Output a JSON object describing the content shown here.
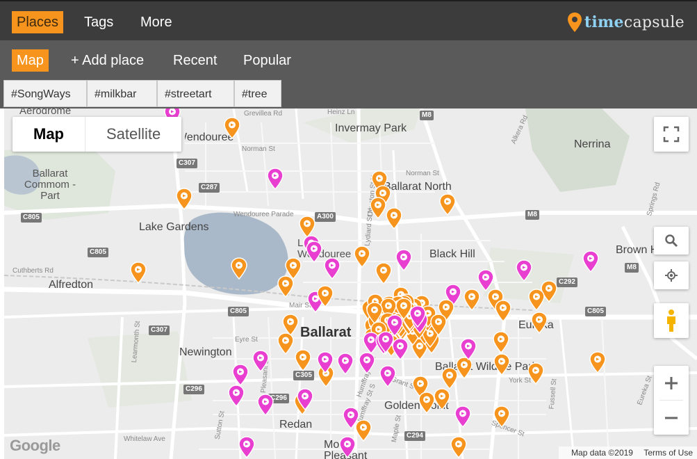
{
  "topbar": {
    "nav": [
      "Places",
      "Tags",
      "More"
    ],
    "active": "Places",
    "logo": {
      "strong": "time",
      "rest": "capsule",
      "pin_color": "#f7941d"
    }
  },
  "subbar": {
    "nav": [
      "Map",
      "+ Add place",
      "Recent",
      "Popular"
    ],
    "active": "Map"
  },
  "tags": [
    "#SongWays",
    "#milkbar",
    "#streetart",
    "#tree"
  ],
  "map": {
    "type_control": {
      "map": "Map",
      "satellite": "Satellite",
      "selected": "Map"
    },
    "places": [
      "Aerodrome",
      "Grevillea Rd",
      "Heinz Ln",
      "Invermay Park",
      "Nerrina",
      "Wendouree",
      "Norman St",
      "Ballarat Commom - Part",
      "Ballarat North",
      "Lake Gardens",
      "Wendouree Parade",
      "Lake Wendouree",
      "Black Hill",
      "Brown Hill",
      "Alfredton",
      "Cuthberts Rd",
      "Mair St",
      "Ballarat",
      "Eyre St",
      "Newington",
      "Ballarat Wildlife Park",
      "Eureka",
      "Golden Point",
      "Redan",
      "Mount Pleasant",
      "Humffray St N",
      "Whitelaw Ave",
      "Sutton St",
      "Learmonth St",
      "Grant St",
      "Pleasant St",
      "Maple St",
      "Spencer St",
      "York St",
      "Fussell St",
      "Eureka St",
      "Springs Rd",
      "Doveton St N",
      "Lydiard St N",
      "Humffray St S",
      "Alkera Rd",
      "Norman St"
    ],
    "roads": [
      "M8",
      "C307",
      "C287",
      "C805",
      "A300",
      "C292",
      "C305",
      "C296",
      "C294",
      "M8"
    ],
    "attribution": [
      "Map data ©2019",
      "Terms of Use"
    ],
    "google_logo": "Google",
    "pin_colors": {
      "orange": "#f7941d",
      "pink": "#e83fd1"
    },
    "pin_counts": {
      "orange": 118,
      "pink": 32
    }
  }
}
